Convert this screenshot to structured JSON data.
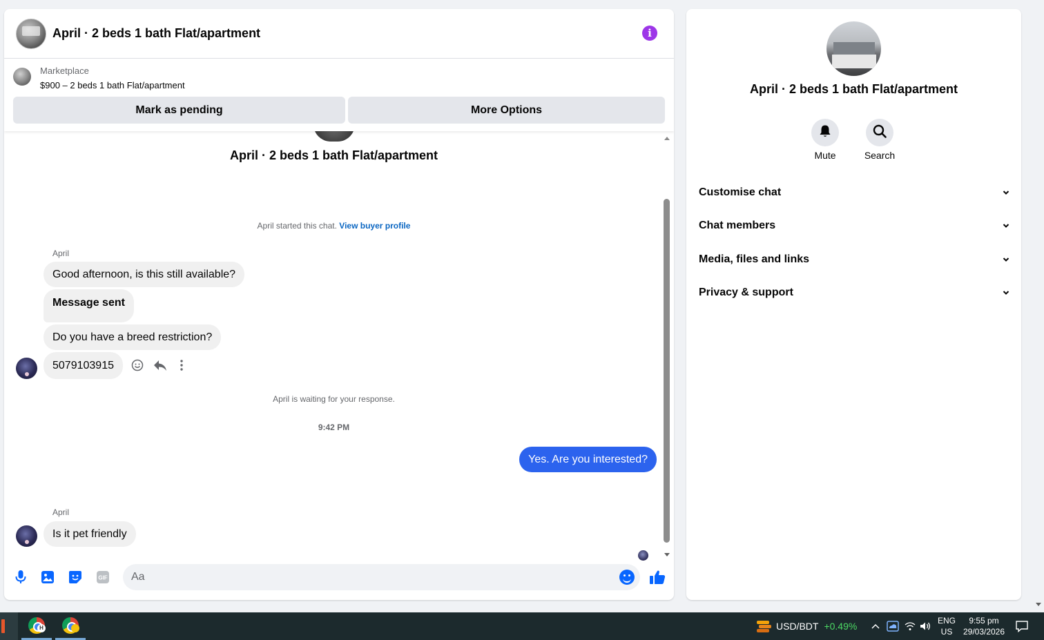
{
  "header": {
    "title": "April · 2 beds 1 bath Flat/apartment"
  },
  "marketplace": {
    "label": "Marketplace",
    "price_line": "$900 – 2 beds 1 bath Flat/apartment",
    "mark_pending_label": "Mark as pending",
    "more_options_label": "More Options"
  },
  "conversation": {
    "intro_title": "April · 2 beds 1 bath Flat/apartment",
    "started_text": "April started this chat.",
    "view_profile_link": "View buyer profile",
    "sender_name_1": "April",
    "messages_in_1": [
      "Good afternoon, is this still available?",
      "Message sent",
      "Do you have a breed restriction?",
      "5079103915"
    ],
    "waiting_text": "April is waiting for your response.",
    "timestamp": "9:42 PM",
    "outgoing_message": "Yes. Are you interested?",
    "sender_name_2": "April",
    "messages_in_2": [
      "Is it pet friendly"
    ]
  },
  "composer": {
    "placeholder": "Aa"
  },
  "side_panel": {
    "title": "April · 2 beds 1 bath Flat/apartment",
    "mute_label": "Mute",
    "search_label": "Search",
    "sections": [
      "Customise chat",
      "Chat members",
      "Media, files and links",
      "Privacy & support"
    ]
  },
  "taskbar": {
    "stock_pair": "USD/BDT",
    "stock_change": "+0.49%",
    "lang_line_1": "ENG",
    "lang_line_2": "US",
    "time": "9:55 pm",
    "date": "29/03/2026"
  },
  "colors": {
    "accent_blue": "#2c63ee",
    "info_purple": "#9d36e8",
    "link_blue": "#0a66c2",
    "icon_blue": "#0866ff",
    "stock_green": "#4cd964"
  },
  "icons": [
    "info-icon",
    "emoji-react-icon",
    "reply-icon",
    "more-icon",
    "microphone-icon",
    "photo-icon",
    "sticker-icon",
    "gif-icon",
    "emoji-icon",
    "thumbs-up-icon",
    "bell-icon",
    "search-icon",
    "chevron-down-icon",
    "chrome-icon",
    "stock-icon",
    "notification-icon"
  ]
}
